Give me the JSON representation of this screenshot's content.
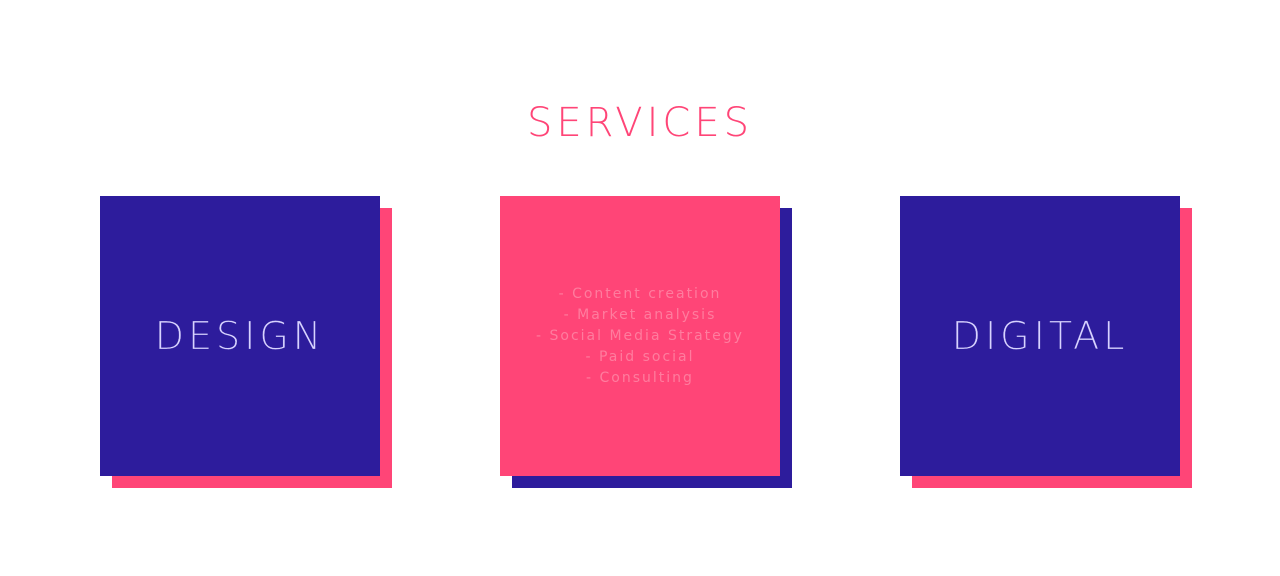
{
  "services": {
    "title": "SERVICES"
  },
  "cards": {
    "design": {
      "title": "DESIGN"
    },
    "marketing": {
      "items": [
        "- Content creation",
        "- Market analysis",
        "- Social Media Strategy",
        "- Paid social",
        "- Consulting"
      ]
    },
    "digital": {
      "title": "DIGITAL"
    }
  },
  "colors": {
    "pink": "#ff4577",
    "indigo": "#2d1c9c",
    "background": "#ffffff"
  }
}
